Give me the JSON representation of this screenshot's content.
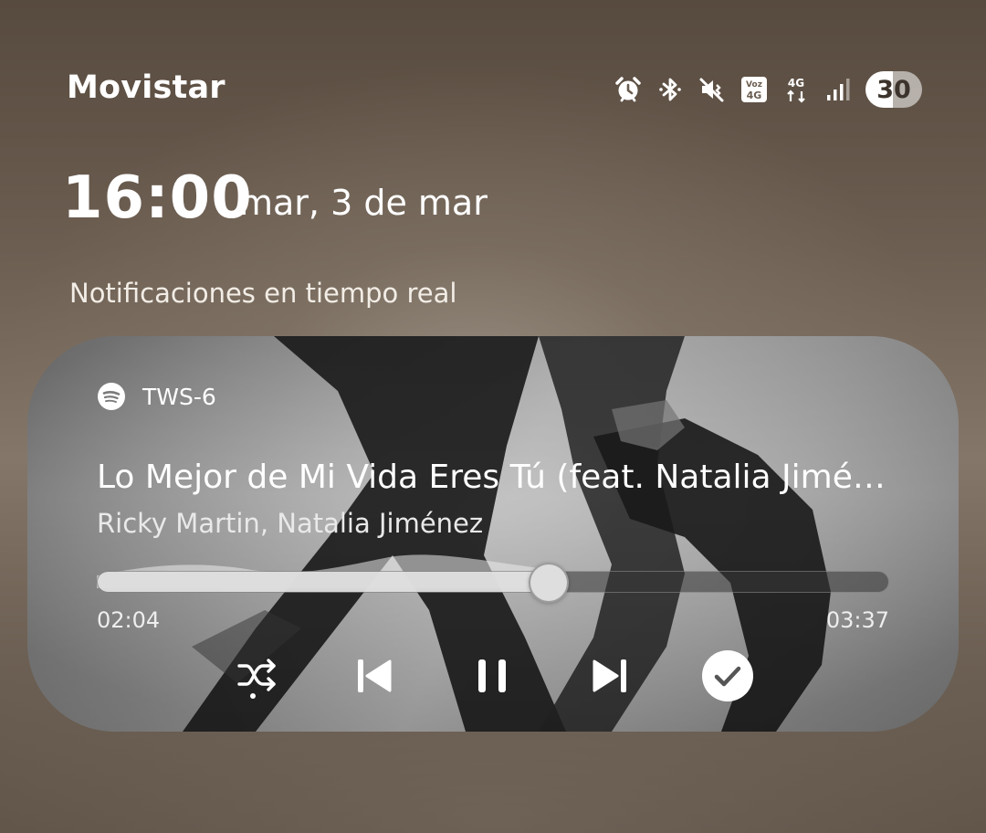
{
  "status_bar": {
    "carrier": "Movistar",
    "icons": [
      "alarm-icon",
      "bluetooth-icon",
      "vibrate-mute-icon",
      "volte-icon",
      "4g-data-icon",
      "signal-icon"
    ],
    "volte_label": "Voz 4G",
    "network_label": "4G",
    "battery_level": "30"
  },
  "lockscreen": {
    "time": "16:00",
    "date": "mar, 3 de mar",
    "section_label": "Notificaciones en tiempo real"
  },
  "media_card": {
    "app_icon": "spotify-icon",
    "output_device": "TWS-6",
    "title": "Lo Mejor de Mi Vida Eres Tú (feat. Natalia Jiménez)",
    "artist": "Ricky Martin, Natalia Jiménez",
    "elapsed": "02:04",
    "total": "03:37",
    "progress_fraction": 0.571,
    "controls": [
      "shuffle-icon",
      "previous-icon",
      "pause-icon",
      "next-icon",
      "check-icon"
    ],
    "colors": {
      "progress_fill": "#e6e6e6",
      "progress_track": "#373737"
    }
  }
}
